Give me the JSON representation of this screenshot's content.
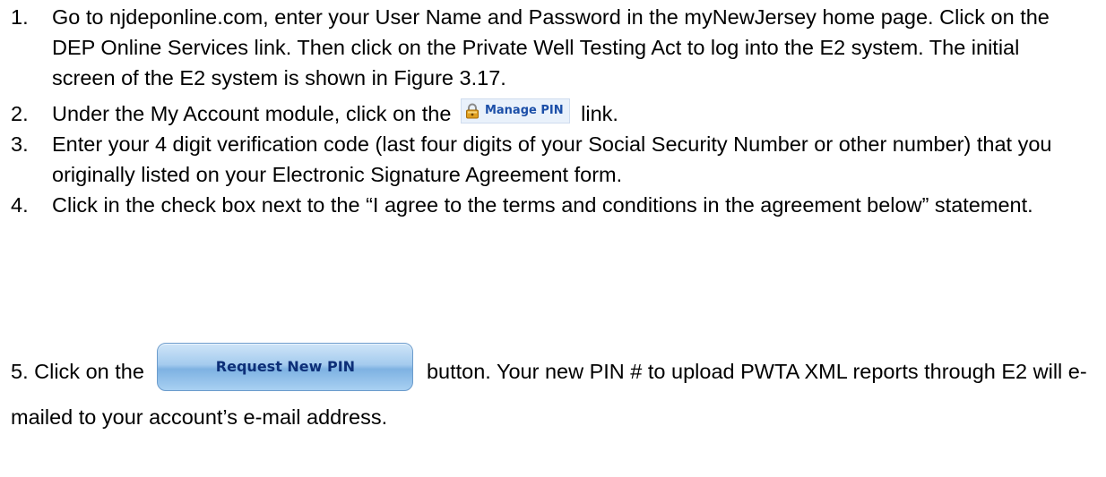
{
  "steps": [
    {
      "number": "1.",
      "text": "Go to njdeponline.com, enter your User Name and Password in the myNewJersey home page.  Click on the DEP Online Services link.  Then click on the Private Well Testing Act to log into the E2 system.  The initial screen of the E2 system is shown in Figure 3.17."
    },
    {
      "number": "2.",
      "text_before": "Under the My Account module, click on the",
      "link_label": "Manage PIN",
      "link_icon": "lock-icon",
      "text_after": "link."
    },
    {
      "number": "3.",
      "text": "Enter your 4 digit verification code (last four digits of your Social Security Number or other number) that you originally listed on your Electronic Signature Agreement form."
    },
    {
      "number": "4.",
      "text": "Click in the check box next to the “I agree to the terms and conditions in the agreement below” statement."
    }
  ],
  "step5": {
    "text_before": "5. Click on the",
    "button_label": "Request New PIN",
    "text_after": "button.  Your new PIN # to upload PWTA XML reports through E2 will e-mailed to your account’s e-mail address."
  },
  "colors": {
    "link_text": "#1c4fa8",
    "button_text": "#0d2f78",
    "button_fill": "#a4cbee",
    "lock_body": "#e0a020"
  }
}
